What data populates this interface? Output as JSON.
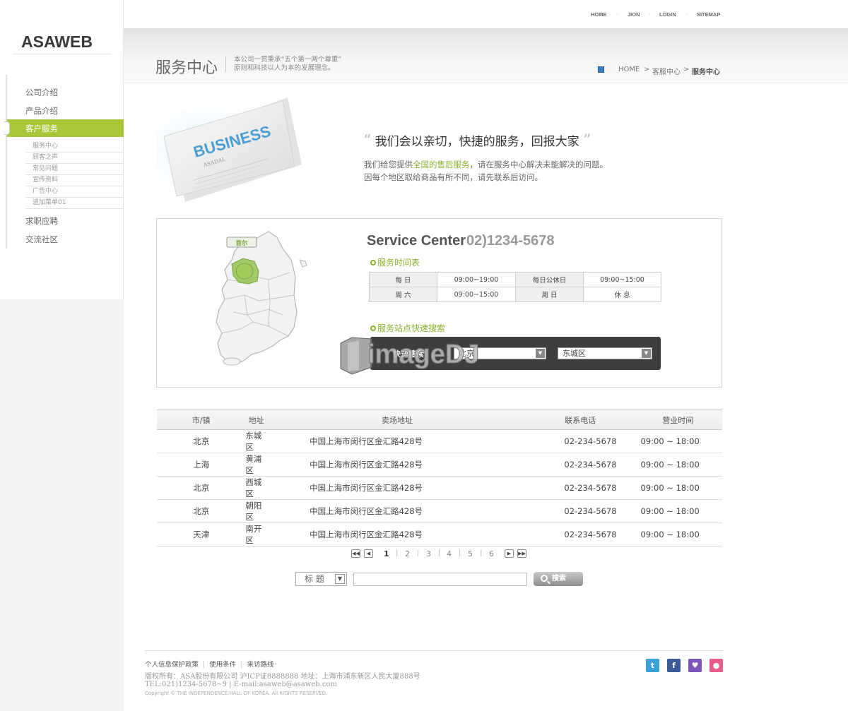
{
  "logo": "ASAWEB",
  "sidebar": {
    "menu": [
      "公司介绍",
      "产品介绍",
      "客户服务",
      "求职应聘",
      "交流社区"
    ],
    "submenu": [
      "服务中心",
      "顾客之声",
      "常见问题",
      "宣传资料",
      "广告中心",
      "追加菜单01"
    ]
  },
  "topnav": [
    "HOME",
    "JION",
    "LOGIN",
    "SITEMAP"
  ],
  "header": {
    "title": "服务中心",
    "desc1": "本公司一贯秉承“五个第一两个尊重”",
    "desc2": "原则和科技以人为本的发展理念。",
    "breadcrumb": [
      "HOME",
      ">",
      "客服中心",
      ">",
      "服务中心"
    ]
  },
  "intro": {
    "card_word": "BUSINESS",
    "card_sub": "ASADAL",
    "headline": "我们会以亲切，快捷的服务，回报大家",
    "open_quote": "“",
    "close_quote": "”",
    "line1_a": "我们给您提供",
    "line1_hl": "全国的售后服务",
    "line1_b": "，请在服务中心解决未能解决的问题。",
    "line2": "因每个地区取给商品有所不同，请先联系后访问。"
  },
  "service": {
    "map_label": "首尔",
    "title": "Service Center",
    "phone": "02)1234-5678",
    "hours_heading": "服务时间表",
    "hours": [
      [
        "每 日",
        "09:00~19:00",
        "每日公休日",
        "09:00~15:00"
      ],
      [
        "周 六",
        "09:00~15:00",
        "周 日",
        "休 息"
      ]
    ],
    "search_heading": "服务站点快速搜索",
    "search_label": "快速搜索",
    "city_select": "北京",
    "district_select": "东城区",
    "watermark": "imageDJ"
  },
  "stores": {
    "headers": [
      "市/镇",
      "地址",
      "卖场地址",
      "联系电话",
      "营业时间"
    ],
    "rows": [
      [
        "北京",
        "东城区",
        "中国上海市闵行区金汇路428号",
        "02-234-5678",
        "09:00 ~ 18:00"
      ],
      [
        "上海",
        "黄浦区",
        "中国上海市闵行区金汇路428号",
        "02-234-5678",
        "09:00 ~ 18:00"
      ],
      [
        "北京",
        "西城区",
        "中国上海市闵行区金汇路428号",
        "02-234-5678",
        "09:00 ~ 18:00"
      ],
      [
        "北京",
        "朝阳区",
        "中国上海市闵行区金汇路428号",
        "02-234-5678",
        "09:00 ~ 18:00"
      ],
      [
        "天津",
        "南开区",
        "中国上海市闵行区金汇路428号",
        "02-234-5678",
        "09:00 ~ 18:00"
      ]
    ]
  },
  "pagination": {
    "pages": [
      "1",
      "2",
      "3",
      "4",
      "5",
      "6"
    ],
    "current": "1"
  },
  "search": {
    "select": "标 题",
    "button": "搜索"
  },
  "footer": {
    "links": [
      "个人信息保护政策",
      "使用条件",
      "来访路线"
    ],
    "line1": "版权所有：ASA股份有限公司 沪ICP证8888888 地址：上海市浦东新区人民大厦888号",
    "line2": "TEL:021)1234-5678~9 | E-mail:asaweb@asaweb.com",
    "copyright": "Copyright © THE INDEPENDENCE HALL OF KOREA. All RIGHTS RESERVED.",
    "social": [
      "twitter-icon",
      "facebook-icon",
      "me2day-icon",
      "pig-icon"
    ],
    "social_colors": [
      "#3aa0d8",
      "#3b5998",
      "#7b55b8",
      "#e85c8a"
    ]
  }
}
